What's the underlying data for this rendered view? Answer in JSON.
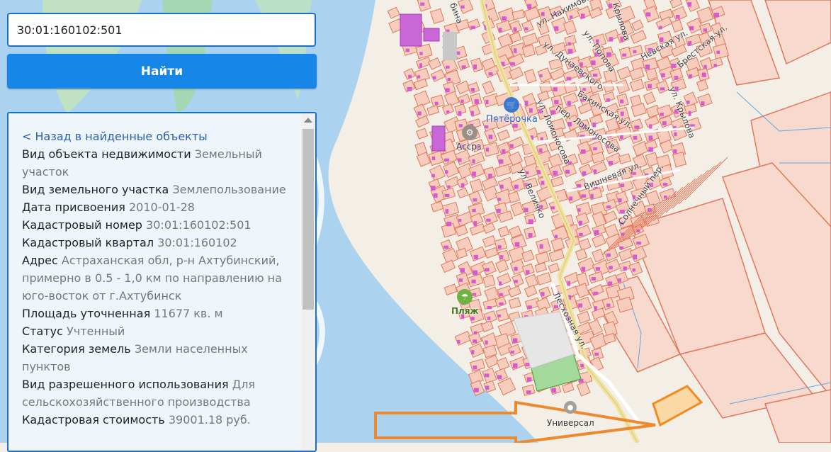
{
  "search": {
    "value": "30:01:160102:501"
  },
  "find_label": "Найти",
  "panel": {
    "back_link": "< Назад в найденные объекты",
    "fields": [
      {
        "label": "Вид объекта недвижимости",
        "value": "Земельный участок"
      },
      {
        "label": "Вид земельного участка",
        "value": "Землепользование"
      },
      {
        "label": "Дата присвоения",
        "value": "2010-01-28"
      },
      {
        "label": "Кадастровый номер",
        "value": "30:01:160102:501"
      },
      {
        "label": "Кадастровый квартал",
        "value": "30:01:160102"
      },
      {
        "label": "Адрес",
        "value": "Астраханская обл, р-н Ахтубинский, примерно в 0.5 - 1,0 км по направлению на юго-восток от г.Ахтубинск"
      },
      {
        "label": "Площадь уточненная",
        "value": "11677 кв. м"
      },
      {
        "label": "Статус",
        "value": "Учтенный"
      },
      {
        "label": "Категория земель",
        "value": "Земли населенных пунктов"
      },
      {
        "label": "Вид разрешенного использования",
        "value": "Для сельскохозяйственного производства"
      },
      {
        "label": "Кадастровая стоимость",
        "value": "39001.18 руб."
      }
    ]
  },
  "map": {
    "streets": {
      "nakhimova": "ул. Нахимова",
      "krylova_top": "Крылова",
      "polova": "ул. Попова",
      "dunaevskogo": "ул. Дунаевского",
      "nevskaya": "Невская ул.",
      "brestskaya": "Брестская ул.",
      "krylova": "ул. Крылова",
      "bakinskaya": "Бакинская ул.",
      "lomonosova_per": "пер. Ломоносова",
      "lomonosova": "ул. Ломоносова",
      "vishnevaya": "Вишневая ул.",
      "velichko": "ул. Величко",
      "solnechny": "Солнечный пер.",
      "leskhoznaya": "Лесхозная ул.",
      "top_fragment": "бина"
    },
    "pois": {
      "pyaterochka": "Пятёрочка",
      "assrz": "Ассрз",
      "beach": "Пляж",
      "universal": "Универсал"
    },
    "colors": {
      "water": "#abd3f0",
      "parcel_fill": "#f6cdbd",
      "parcel_stroke": "#e2775a",
      "building": "#d85ad0",
      "highlight": "#f28a1e",
      "green": "#a3d99a"
    }
  }
}
